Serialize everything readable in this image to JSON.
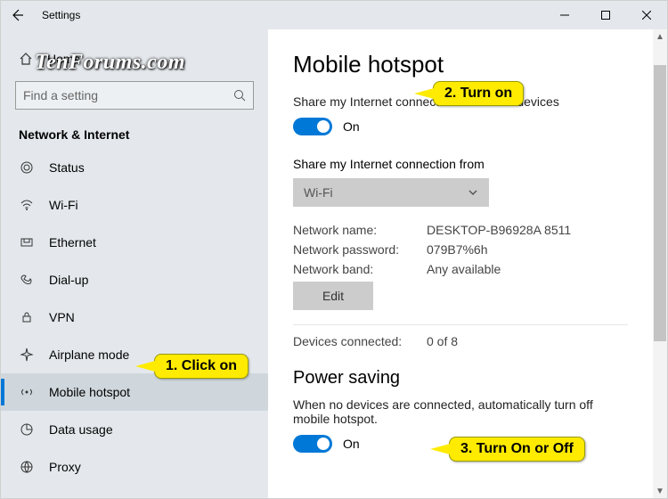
{
  "window": {
    "title": "Settings"
  },
  "watermark": "TenForums.com",
  "sidebar": {
    "home": "Home",
    "search_placeholder": "Find a setting",
    "group": "Network & Internet",
    "items": [
      {
        "label": "Status"
      },
      {
        "label": "Wi-Fi"
      },
      {
        "label": "Ethernet"
      },
      {
        "label": "Dial-up"
      },
      {
        "label": "VPN"
      },
      {
        "label": "Airplane mode"
      },
      {
        "label": "Mobile hotspot"
      },
      {
        "label": "Data usage"
      },
      {
        "label": "Proxy"
      }
    ]
  },
  "page": {
    "title": "Mobile hotspot",
    "share_desc": "Share my Internet connection with other devices",
    "share_toggle": "On",
    "from_label": "Share my Internet connection from",
    "from_value": "Wi-Fi",
    "net_name_label": "Network name:",
    "net_name_value": "DESKTOP-B96928A 8511",
    "net_pass_label": "Network password:",
    "net_pass_value": "079B7%6h",
    "net_band_label": "Network band:",
    "net_band_value": "Any available",
    "edit_label": "Edit",
    "devices_label": "Devices connected:",
    "devices_value": "0 of 8",
    "power_section": "Power saving",
    "power_desc": "When no devices are connected, automatically turn off mobile hotspot.",
    "power_toggle": "On"
  },
  "callouts": {
    "c1": "1. Click on",
    "c2": "2. Turn on",
    "c3": "3. Turn On or Off"
  }
}
